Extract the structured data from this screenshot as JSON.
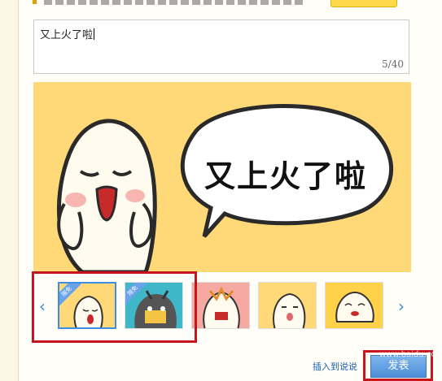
{
  "compose": {
    "text": "又上火了啦",
    "counter": "5/40"
  },
  "preview": {
    "bubble_text": "又上火了啦"
  },
  "thumbnails": {
    "prev_arrow": "‹",
    "next_arrow": "›",
    "items": [
      {
        "tag": "限免",
        "selected": true
      },
      {
        "tag": "限免",
        "selected": false
      },
      {
        "tag": "",
        "selected": false
      },
      {
        "tag": "",
        "selected": false
      },
      {
        "tag": "",
        "selected": false
      }
    ]
  },
  "footer": {
    "insert_link": "插入到说说",
    "publish_label": "发表",
    "watermark": "www.baidu.com"
  },
  "colors": {
    "accent": "#3d8ee0",
    "highlight": "#c8141c",
    "preview_bg": "#ffd978"
  }
}
